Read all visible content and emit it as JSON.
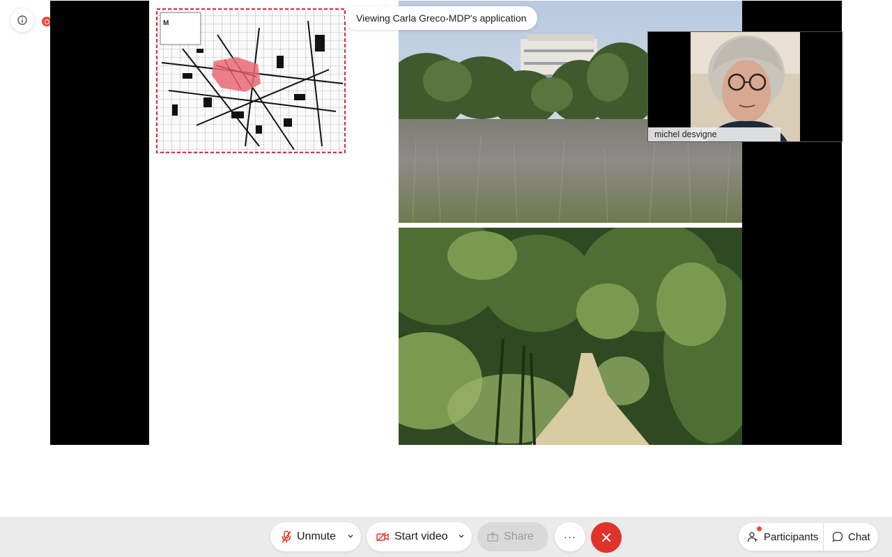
{
  "session": {
    "viewing_banner": "Viewing Carla Greco-MDP's application"
  },
  "video_tile": {
    "participant_name": "michel desvigne"
  },
  "controls": {
    "unmute_label": "Unmute",
    "start_video_label": "Start video",
    "share_label": "Share",
    "more_label": "···",
    "participants_label": "Participants",
    "chat_label": "Chat"
  },
  "colors": {
    "end_call": "#e0332a",
    "recording": "#e8493b",
    "control_bar_bg": "#ebebeb"
  },
  "icons": [
    "info-icon",
    "recording-icon",
    "muted-microphone-icon",
    "video-off-icon",
    "share-icon",
    "more-icon",
    "close-icon",
    "participants-icon",
    "chat-icon",
    "chevron-down-icon"
  ]
}
